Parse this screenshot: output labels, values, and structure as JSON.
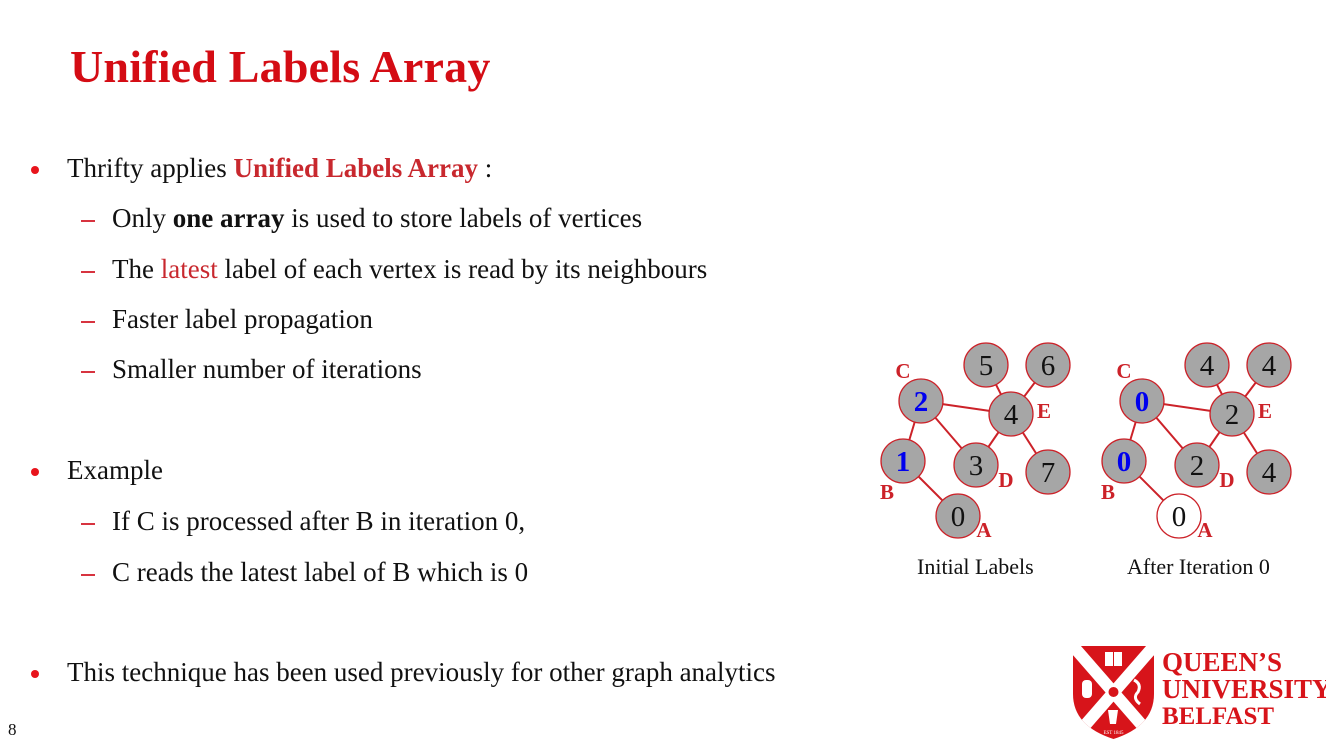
{
  "slide": {
    "title": "Unified Labels Array",
    "page_number": "8"
  },
  "bullets": [
    {
      "parts": [
        "Thrifty applies ",
        "Unified Labels Array",
        " :"
      ],
      "subs": [
        {
          "parts": [
            "Only ",
            "one array",
            " is used to store labels of vertices"
          ]
        },
        {
          "parts": [
            "The ",
            "latest",
            " label of each vertex is read by its neighbours"
          ]
        },
        {
          "text": "Faster label propagation"
        },
        {
          "text": "Smaller number of iterations"
        }
      ]
    },
    {
      "text": "Example",
      "subs": [
        {
          "text": "If C is processed after B in iteration 0,"
        },
        {
          "text": "C reads the latest label of B which is 0"
        }
      ]
    },
    {
      "text": "This technique has been used previously for other graph analytics"
    }
  ],
  "figure": {
    "graphs": [
      {
        "caption": "Initial Labels",
        "nodes": [
          {
            "id": "A",
            "label": "0",
            "letter": "A",
            "fill": "#a6a6a6",
            "text_color": "#111111",
            "bold": false
          },
          {
            "id": "B",
            "label": "1",
            "letter": "B",
            "fill": "#a6a6a6",
            "text_color": "#0000ee",
            "bold": true
          },
          {
            "id": "C",
            "label": "2",
            "letter": "C",
            "fill": "#a6a6a6",
            "text_color": "#0000ee",
            "bold": true
          },
          {
            "id": "D",
            "label": "3",
            "letter": "D",
            "fill": "#a6a6a6",
            "text_color": "#111111",
            "bold": false
          },
          {
            "id": "E",
            "label": "4",
            "letter": "E",
            "fill": "#a6a6a6",
            "text_color": "#111111",
            "bold": false
          },
          {
            "id": "F",
            "label": "5",
            "letter": "",
            "fill": "#a6a6a6",
            "text_color": "#111111",
            "bold": false
          },
          {
            "id": "G",
            "label": "6",
            "letter": "",
            "fill": "#a6a6a6",
            "text_color": "#111111",
            "bold": false
          },
          {
            "id": "H",
            "label": "7",
            "letter": "",
            "fill": "#a6a6a6",
            "text_color": "#111111",
            "bold": false
          }
        ]
      },
      {
        "caption": "After Iteration 0",
        "nodes": [
          {
            "id": "A",
            "label": "0",
            "letter": "A",
            "fill": "#ffffff",
            "text_color": "#111111",
            "bold": false
          },
          {
            "id": "B",
            "label": "0",
            "letter": "B",
            "fill": "#a6a6a6",
            "text_color": "#0000ee",
            "bold": true
          },
          {
            "id": "C",
            "label": "0",
            "letter": "C",
            "fill": "#a6a6a6",
            "text_color": "#0000ee",
            "bold": true
          },
          {
            "id": "D",
            "label": "2",
            "letter": "D",
            "fill": "#a6a6a6",
            "text_color": "#111111",
            "bold": false
          },
          {
            "id": "E",
            "label": "2",
            "letter": "E",
            "fill": "#a6a6a6",
            "text_color": "#111111",
            "bold": false
          },
          {
            "id": "F",
            "label": "4",
            "letter": "",
            "fill": "#a6a6a6",
            "text_color": "#111111",
            "bold": false
          },
          {
            "id": "G",
            "label": "4",
            "letter": "",
            "fill": "#a6a6a6",
            "text_color": "#111111",
            "bold": false
          },
          {
            "id": "H",
            "label": "4",
            "letter": "",
            "fill": "#a6a6a6",
            "text_color": "#111111",
            "bold": false
          }
        ]
      }
    ],
    "edges": [
      [
        "A",
        "B"
      ],
      [
        "B",
        "C"
      ],
      [
        "C",
        "E"
      ],
      [
        "C",
        "D"
      ],
      [
        "D",
        "E"
      ],
      [
        "E",
        "F"
      ],
      [
        "E",
        "G"
      ],
      [
        "E",
        "H"
      ]
    ],
    "colors": {
      "edge": "#cc2229",
      "node_stroke": "#cc2229",
      "letter": "#cc2229"
    }
  },
  "logo": {
    "line1": "QUEEN’S",
    "line2": "UNIVERSITY",
    "line3": "BELFAST",
    "est": "EST 1845",
    "color": "#d7141a"
  }
}
